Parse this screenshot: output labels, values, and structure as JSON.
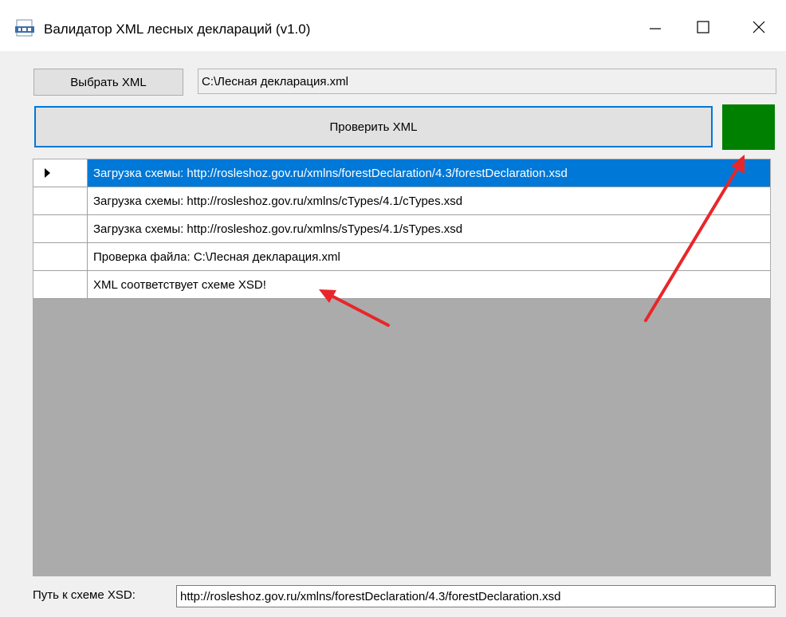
{
  "window": {
    "title": "Валидатор XML лесных деклараций (v1.0)",
    "icon": "xml-file-icon",
    "controls": [
      "minimize-icon",
      "maximize-icon",
      "close-icon"
    ]
  },
  "toolbar": {
    "select_xml_label": "Выбрать XML",
    "file_path": "C:\\Лесная декларация.xml",
    "check_xml_label": "Проверить XML",
    "status_color": "#008000"
  },
  "log": {
    "rows": [
      {
        "text": "Загрузка схемы: http://rosleshoz.gov.ru/xmlns/forestDeclaration/4.3/forestDeclaration.xsd",
        "selected": true
      },
      {
        "text": "Загрузка схемы: http://rosleshoz.gov.ru/xmlns/cTypes/4.1/cTypes.xsd",
        "selected": false
      },
      {
        "text": "Загрузка схемы: http://rosleshoz.gov.ru/xmlns/sTypes/4.1/sTypes.xsd",
        "selected": false
      },
      {
        "text": "Проверка файла: C:\\Лесная декларация.xml",
        "selected": false
      },
      {
        "text": "XML соответствует схеме XSD!",
        "selected": false
      }
    ]
  },
  "footer": {
    "xsd_label": "Путь к схеме XSD:",
    "xsd_path": "http://rosleshoz.gov.ru/xmlns/forestDeclaration/4.3/forestDeclaration.xsd"
  },
  "annotation": {
    "arrow_color": "#e8262a"
  }
}
